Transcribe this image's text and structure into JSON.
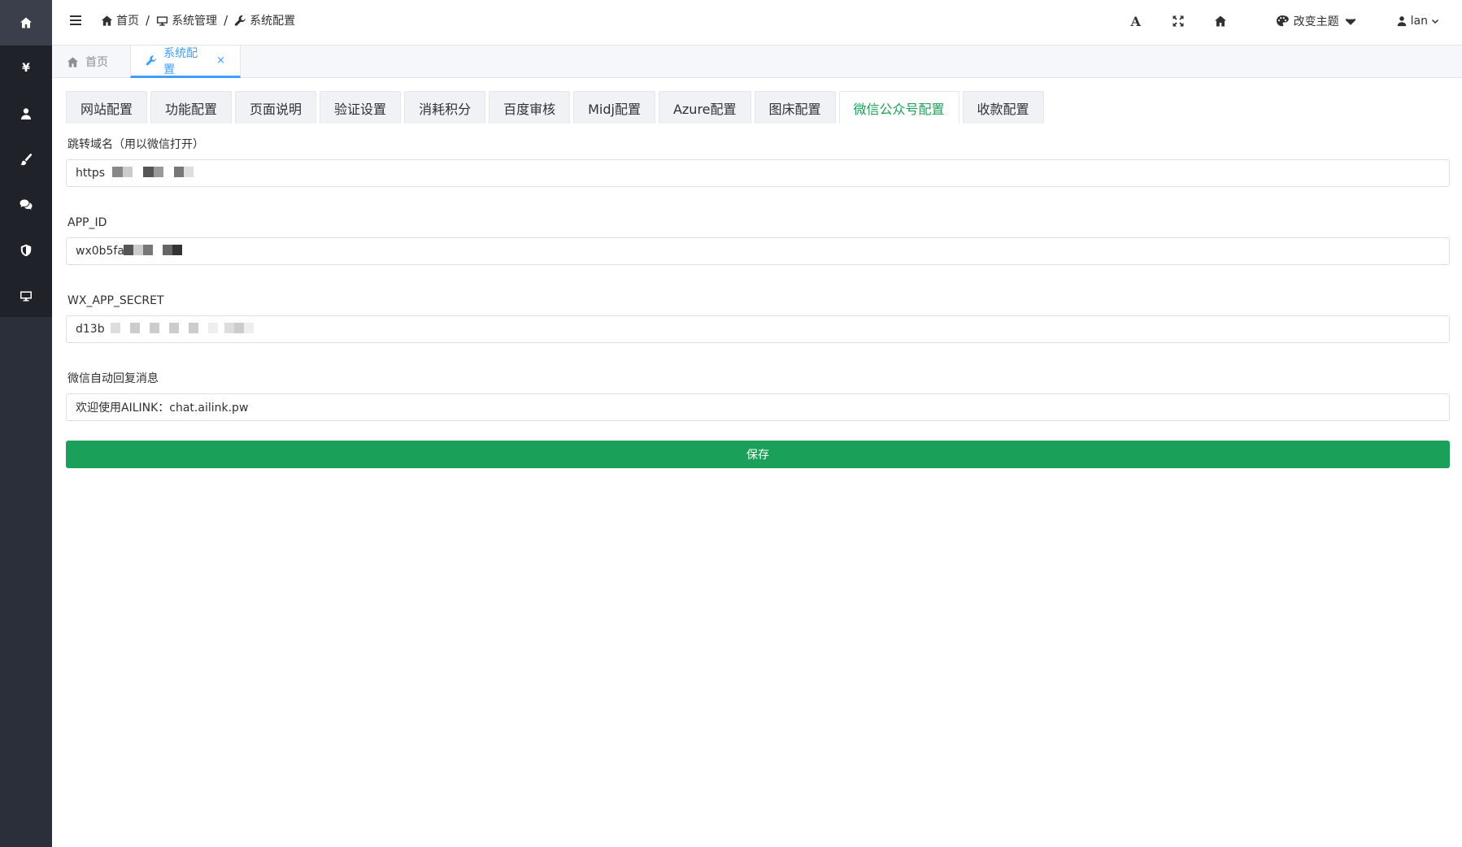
{
  "header": {
    "breadcrumb": [
      {
        "label": "首页",
        "icon": "home-icon"
      },
      {
        "label": "系统管理",
        "icon": "monitor-icon"
      },
      {
        "label": "系统配置",
        "icon": "wrench-icon"
      }
    ],
    "separator": "/",
    "font_icon_label": "A",
    "theme_label": "改变主题",
    "user_label": "lan"
  },
  "page_tabs": [
    {
      "label": "首页",
      "icon": "home-icon"
    },
    {
      "label": "系统配置",
      "icon": "wrench-icon",
      "close": "×"
    }
  ],
  "config_tabs": [
    "网站配置",
    "功能配置",
    "页面说明",
    "验证设置",
    "消耗积分",
    "百度审核",
    "Midj配置",
    "Azure配置",
    "图床配置",
    "微信公众号配置",
    "收款配置"
  ],
  "active_config_tab": "微信公众号配置",
  "form": {
    "redirect_domain": {
      "label": "跳转域名（用以微信打开）",
      "value": "https"
    },
    "app_id": {
      "label": "APP_ID",
      "value": "wx0b5fa"
    },
    "app_secret": {
      "label": "WX_APP_SECRET",
      "value": "d13b"
    },
    "auto_reply": {
      "label": "微信自动回复消息",
      "value": "欢迎使用AILINK：chat.ailink.pw"
    },
    "save_label": "保存"
  },
  "sidebar": {
    "items": [
      "home-icon",
      "yen-icon",
      "user-icon",
      "brush-icon",
      "chat-icon",
      "shield-icon",
      "monitor-icon"
    ],
    "yen_glyph": "¥"
  },
  "colors": {
    "sidebar": "#2b2f3a",
    "sidebar_top": "#1f2229",
    "accent_green": "#1ba05a",
    "accent_blue": "#409eff"
  }
}
